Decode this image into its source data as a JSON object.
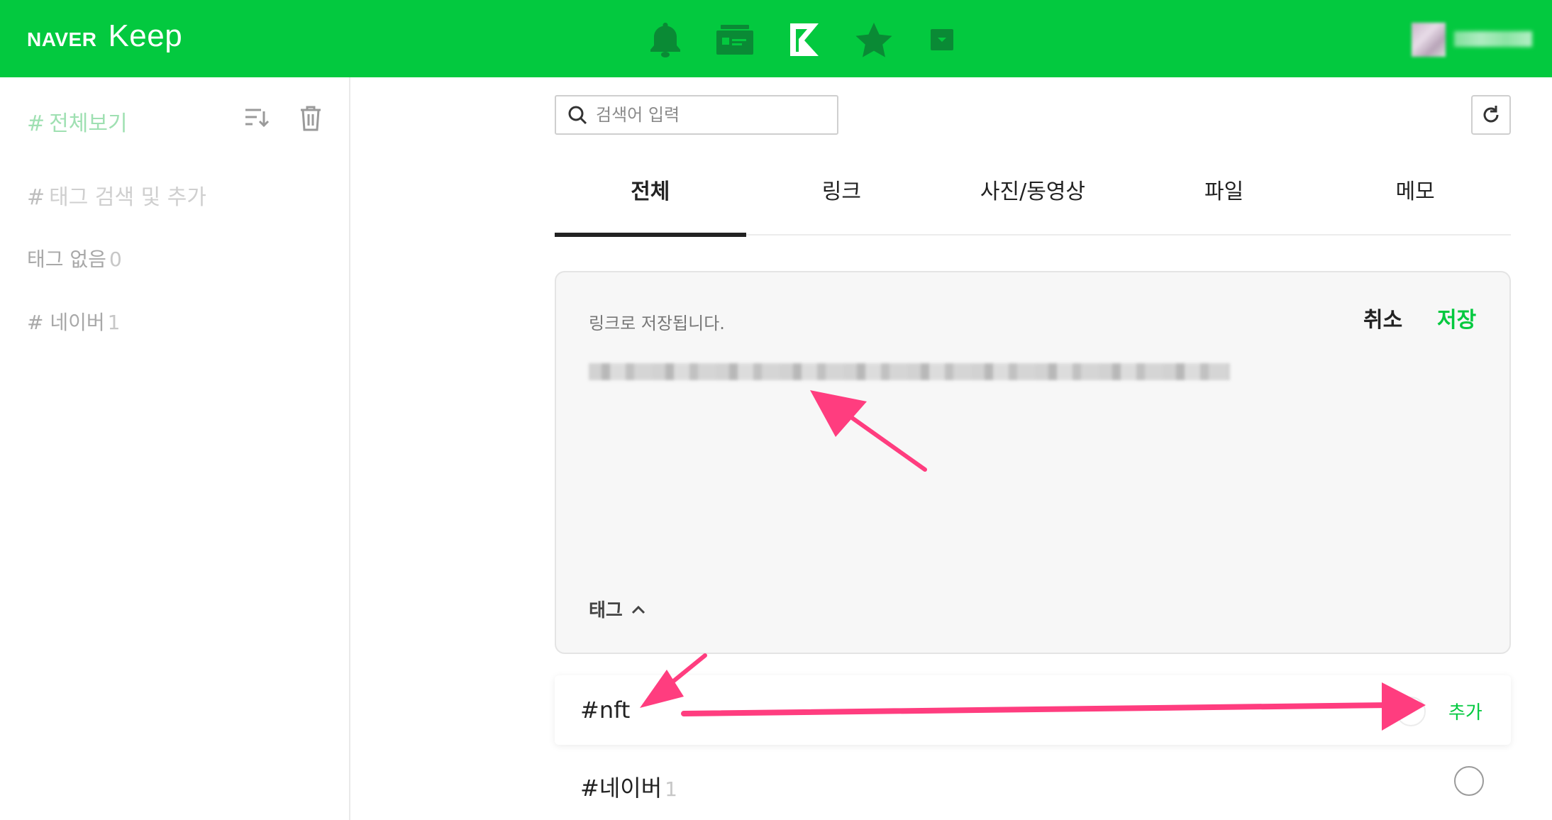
{
  "header": {
    "brand": "NAVER",
    "app_name": "Keep",
    "icons": [
      "bell-icon",
      "card-icon",
      "keep-k-icon",
      "star-icon",
      "inbox-icon"
    ],
    "accent": "#03c93f"
  },
  "sidebar": {
    "all_label": "전체보기",
    "tag_search_placeholder": "태그 검색 및 추가",
    "items": [
      {
        "label": "태그 없음",
        "count": "0"
      },
      {
        "label": "네이버",
        "count": "1"
      }
    ]
  },
  "search": {
    "placeholder": "검색어 입력"
  },
  "tabs": [
    "전체",
    "링크",
    "사진/동영상",
    "파일",
    "메모"
  ],
  "editor": {
    "info_text": "링크로 저장됩니다.",
    "cancel_label": "취소",
    "save_label": "저장",
    "tag_toggle_label": "태그"
  },
  "tag_list": [
    {
      "name": "nft",
      "action": "추가"
    },
    {
      "name": "네이버",
      "count": "1"
    }
  ],
  "colors": {
    "accent": "#03c93f",
    "annotation_arrow": "#ff3d7f"
  }
}
